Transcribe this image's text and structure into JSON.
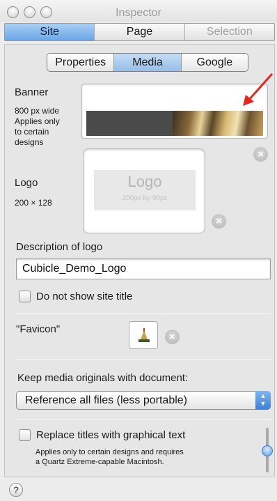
{
  "window": {
    "title": "Inspector"
  },
  "top_tabs": [
    {
      "label": "Site",
      "active": true
    },
    {
      "label": "Page",
      "active": false
    },
    {
      "label": "Selection",
      "active": false
    }
  ],
  "sub_tabs": [
    {
      "label": "Properties",
      "active": false
    },
    {
      "label": "Media",
      "active": true
    },
    {
      "label": "Google",
      "active": false
    }
  ],
  "banner": {
    "label": "Banner",
    "note_line1": "800 px wide",
    "note_line2": "Applies only",
    "note_line3": "to certain",
    "note_line4": "designs"
  },
  "logo": {
    "label": "Logo",
    "size": "200 × 128",
    "placeholder_title": "Logo",
    "placeholder_sub": "200px by 90px"
  },
  "description": {
    "label": "Description of logo",
    "value": "Cubicle_Demo_Logo"
  },
  "hide_title": {
    "label": "Do not show site title",
    "checked": false
  },
  "favicon": {
    "label": "\"Favicon\""
  },
  "media": {
    "label": "Keep media originals with document:",
    "selected": "Reference all files (less portable)"
  },
  "graphical_text": {
    "label": "Replace titles with graphical text",
    "note_line1": "Applies only to certain designs and requires",
    "note_line2": "a Quartz Extreme-capable Macintosh.",
    "checked": false
  },
  "help": {
    "label": "?"
  },
  "colors": {
    "accent": "#6aa6e6",
    "arrow": "#e0281e"
  }
}
